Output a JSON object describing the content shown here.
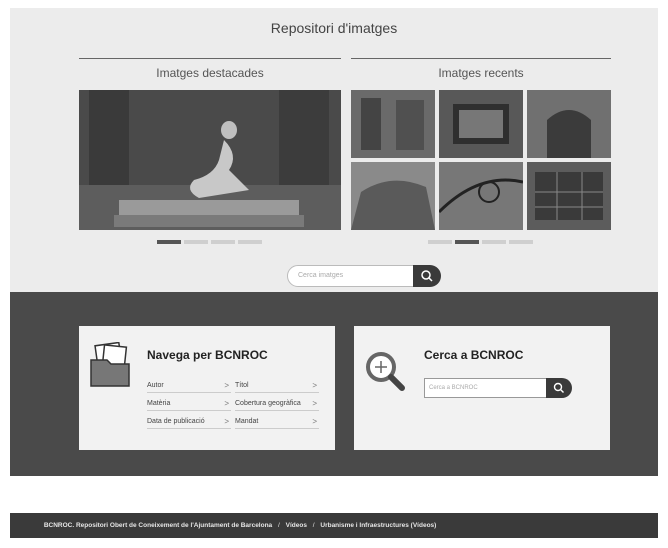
{
  "page_title": "Repositori d'imatges",
  "featured": {
    "title": "Imatges destacades",
    "slides": 4,
    "active_slide": 1
  },
  "recent": {
    "title": "Imatges recents",
    "slides": 4,
    "active_slide": 2
  },
  "image_search": {
    "placeholder": "Cerca imatges",
    "button_icon": "search-icon"
  },
  "browse_card": {
    "title": "Navega per BCNROC",
    "icon": "folder-icon",
    "items": [
      {
        "label": "Autor"
      },
      {
        "label": "Títol"
      },
      {
        "label": "Matèria"
      },
      {
        "label": "Cobertura geogràfica"
      },
      {
        "label": "Data de publicació"
      },
      {
        "label": "Mandat"
      }
    ]
  },
  "search_card": {
    "title": "Cerca a BCNROC",
    "icon": "magnifier-plus-icon",
    "placeholder": "Cerca a BCNROC",
    "button_icon": "search-icon"
  },
  "footer": {
    "breadcrumb": [
      "BCNROC. Repositori Obert de Coneixement de l'Ajuntament de Barcelona",
      "Vídeos",
      "Urbanisme i Infraestructures (Vídeos)"
    ],
    "separator": "/"
  },
  "colors": {
    "top_bg": "#ececec",
    "dark_band": "#4a4a4a",
    "footer_bg": "#3a3a3a",
    "accent": "#3a3a3a"
  }
}
